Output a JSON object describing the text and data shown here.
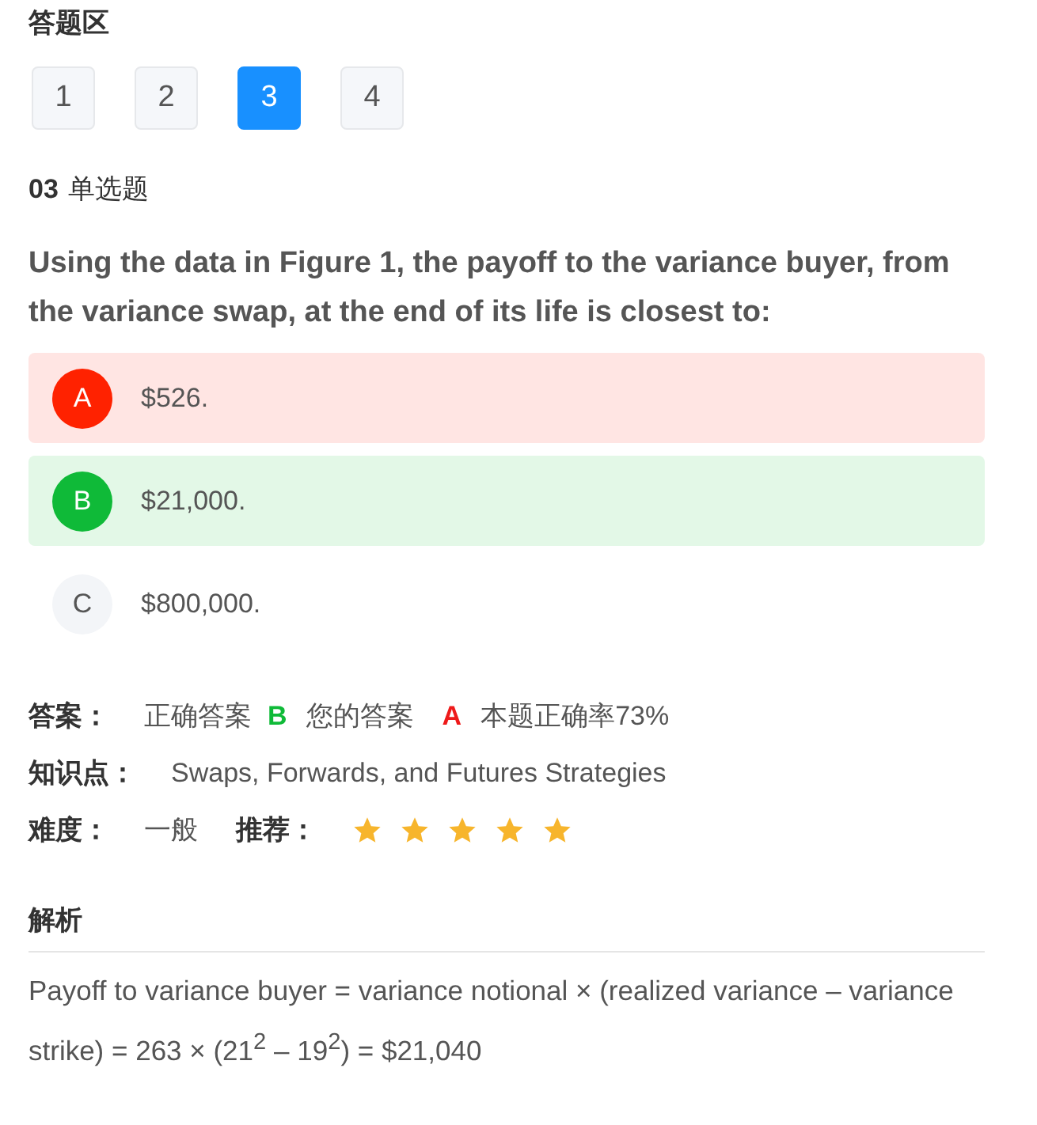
{
  "section_title": "答题区",
  "question_nav": [
    {
      "label": "1",
      "selected": false
    },
    {
      "label": "2",
      "selected": false
    },
    {
      "label": "3",
      "selected": true
    },
    {
      "label": "4",
      "selected": false
    }
  ],
  "question": {
    "number": "03",
    "type": "单选题",
    "text": "Using the data in Figure 1, the payoff to the variance buyer, from the variance swap, at the end of its life is closest to:"
  },
  "options": [
    {
      "letter": "A",
      "text": "$526.",
      "kind": "wrong"
    },
    {
      "letter": "B",
      "text": "$21,000.",
      "kind": "correct"
    },
    {
      "letter": "C",
      "text": "$800,000.",
      "kind": "plain"
    }
  ],
  "answer": {
    "label": "答案：",
    "correct_label": "正确答案",
    "correct": "B",
    "yours_label": "您的答案",
    "yours": "A",
    "rate": "本题正确率73%"
  },
  "knowledge": {
    "label": "知识点：",
    "value": "Swaps, Forwards, and Futures Strategies"
  },
  "difficulty": {
    "label": "难度：",
    "value": "一般"
  },
  "recommend": {
    "label": "推荐：",
    "stars": 5
  },
  "analysis": {
    "title": "解析",
    "text": "Payoff to variance buyer = variance notional × (realized variance – variance strike) = 263 × (21$^{2}$ – 19$^{2}$) = $21,040"
  }
}
